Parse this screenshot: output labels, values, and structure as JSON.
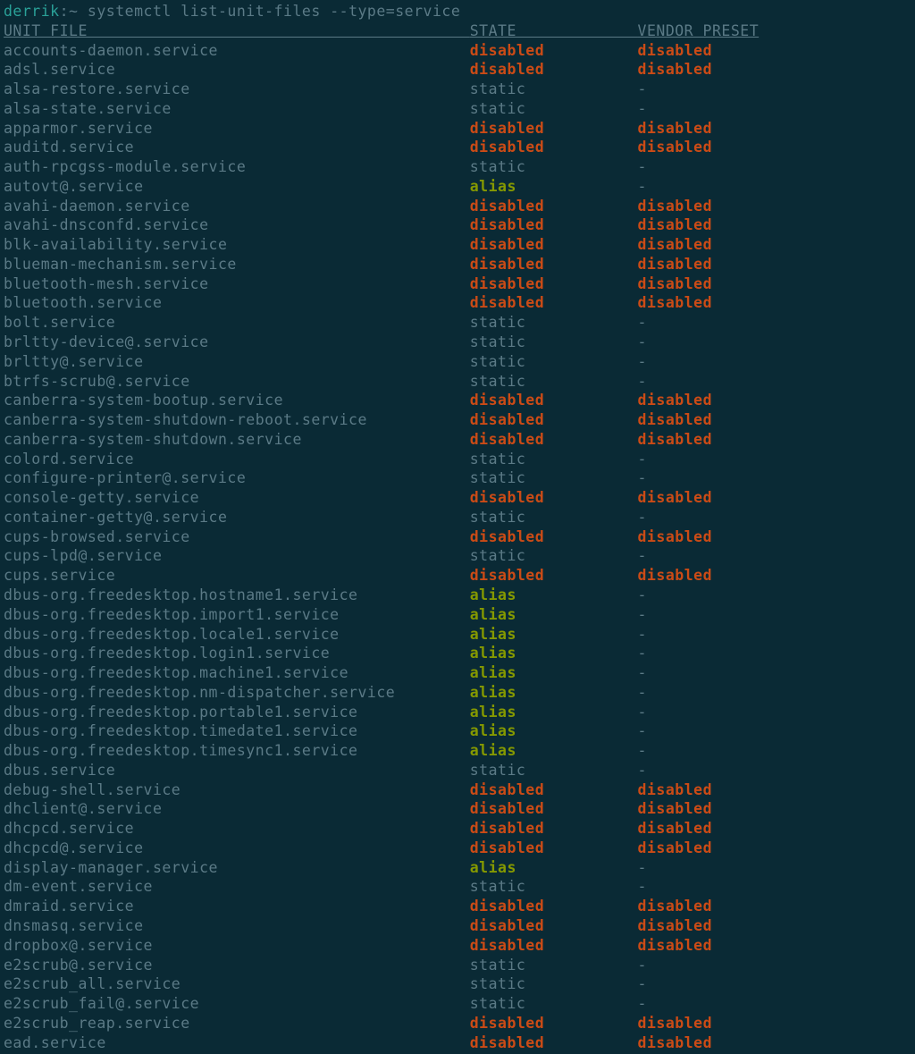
{
  "prompt": {
    "user": "derrik",
    "path": "~",
    "command": "systemctl list-unit-files --type=service"
  },
  "headers": {
    "unit_file": "UNIT FILE",
    "state": "STATE",
    "vendor_preset": "VENDOR PRESET"
  },
  "columns": {
    "unit_width": 50,
    "state_width": 18
  },
  "rows": [
    {
      "unit": "accounts-daemon.service",
      "state": "disabled",
      "preset": "disabled"
    },
    {
      "unit": "adsl.service",
      "state": "disabled",
      "preset": "disabled"
    },
    {
      "unit": "alsa-restore.service",
      "state": "static",
      "preset": "-"
    },
    {
      "unit": "alsa-state.service",
      "state": "static",
      "preset": "-"
    },
    {
      "unit": "apparmor.service",
      "state": "disabled",
      "preset": "disabled"
    },
    {
      "unit": "auditd.service",
      "state": "disabled",
      "preset": "disabled"
    },
    {
      "unit": "auth-rpcgss-module.service",
      "state": "static",
      "preset": "-"
    },
    {
      "unit": "autovt@.service",
      "state": "alias",
      "preset": "-"
    },
    {
      "unit": "avahi-daemon.service",
      "state": "disabled",
      "preset": "disabled"
    },
    {
      "unit": "avahi-dnsconfd.service",
      "state": "disabled",
      "preset": "disabled"
    },
    {
      "unit": "blk-availability.service",
      "state": "disabled",
      "preset": "disabled"
    },
    {
      "unit": "blueman-mechanism.service",
      "state": "disabled",
      "preset": "disabled"
    },
    {
      "unit": "bluetooth-mesh.service",
      "state": "disabled",
      "preset": "disabled"
    },
    {
      "unit": "bluetooth.service",
      "state": "disabled",
      "preset": "disabled"
    },
    {
      "unit": "bolt.service",
      "state": "static",
      "preset": "-"
    },
    {
      "unit": "brltty-device@.service",
      "state": "static",
      "preset": "-"
    },
    {
      "unit": "brltty@.service",
      "state": "static",
      "preset": "-"
    },
    {
      "unit": "btrfs-scrub@.service",
      "state": "static",
      "preset": "-"
    },
    {
      "unit": "canberra-system-bootup.service",
      "state": "disabled",
      "preset": "disabled"
    },
    {
      "unit": "canberra-system-shutdown-reboot.service",
      "state": "disabled",
      "preset": "disabled"
    },
    {
      "unit": "canberra-system-shutdown.service",
      "state": "disabled",
      "preset": "disabled"
    },
    {
      "unit": "colord.service",
      "state": "static",
      "preset": "-"
    },
    {
      "unit": "configure-printer@.service",
      "state": "static",
      "preset": "-"
    },
    {
      "unit": "console-getty.service",
      "state": "disabled",
      "preset": "disabled"
    },
    {
      "unit": "container-getty@.service",
      "state": "static",
      "preset": "-"
    },
    {
      "unit": "cups-browsed.service",
      "state": "disabled",
      "preset": "disabled"
    },
    {
      "unit": "cups-lpd@.service",
      "state": "static",
      "preset": "-"
    },
    {
      "unit": "cups.service",
      "state": "disabled",
      "preset": "disabled"
    },
    {
      "unit": "dbus-org.freedesktop.hostname1.service",
      "state": "alias",
      "preset": "-"
    },
    {
      "unit": "dbus-org.freedesktop.import1.service",
      "state": "alias",
      "preset": "-"
    },
    {
      "unit": "dbus-org.freedesktop.locale1.service",
      "state": "alias",
      "preset": "-"
    },
    {
      "unit": "dbus-org.freedesktop.login1.service",
      "state": "alias",
      "preset": "-"
    },
    {
      "unit": "dbus-org.freedesktop.machine1.service",
      "state": "alias",
      "preset": "-"
    },
    {
      "unit": "dbus-org.freedesktop.nm-dispatcher.service",
      "state": "alias",
      "preset": "-"
    },
    {
      "unit": "dbus-org.freedesktop.portable1.service",
      "state": "alias",
      "preset": "-"
    },
    {
      "unit": "dbus-org.freedesktop.timedate1.service",
      "state": "alias",
      "preset": "-"
    },
    {
      "unit": "dbus-org.freedesktop.timesync1.service",
      "state": "alias",
      "preset": "-"
    },
    {
      "unit": "dbus.service",
      "state": "static",
      "preset": "-"
    },
    {
      "unit": "debug-shell.service",
      "state": "disabled",
      "preset": "disabled"
    },
    {
      "unit": "dhclient@.service",
      "state": "disabled",
      "preset": "disabled"
    },
    {
      "unit": "dhcpcd.service",
      "state": "disabled",
      "preset": "disabled"
    },
    {
      "unit": "dhcpcd@.service",
      "state": "disabled",
      "preset": "disabled"
    },
    {
      "unit": "display-manager.service",
      "state": "alias",
      "preset": "-"
    },
    {
      "unit": "dm-event.service",
      "state": "static",
      "preset": "-"
    },
    {
      "unit": "dmraid.service",
      "state": "disabled",
      "preset": "disabled"
    },
    {
      "unit": "dnsmasq.service",
      "state": "disabled",
      "preset": "disabled"
    },
    {
      "unit": "dropbox@.service",
      "state": "disabled",
      "preset": "disabled"
    },
    {
      "unit": "e2scrub@.service",
      "state": "static",
      "preset": "-"
    },
    {
      "unit": "e2scrub_all.service",
      "state": "static",
      "preset": "-"
    },
    {
      "unit": "e2scrub_fail@.service",
      "state": "static",
      "preset": "-"
    },
    {
      "unit": "e2scrub_reap.service",
      "state": "disabled",
      "preset": "disabled"
    },
    {
      "unit": "ead.service",
      "state": "disabled",
      "preset": "disabled"
    }
  ]
}
